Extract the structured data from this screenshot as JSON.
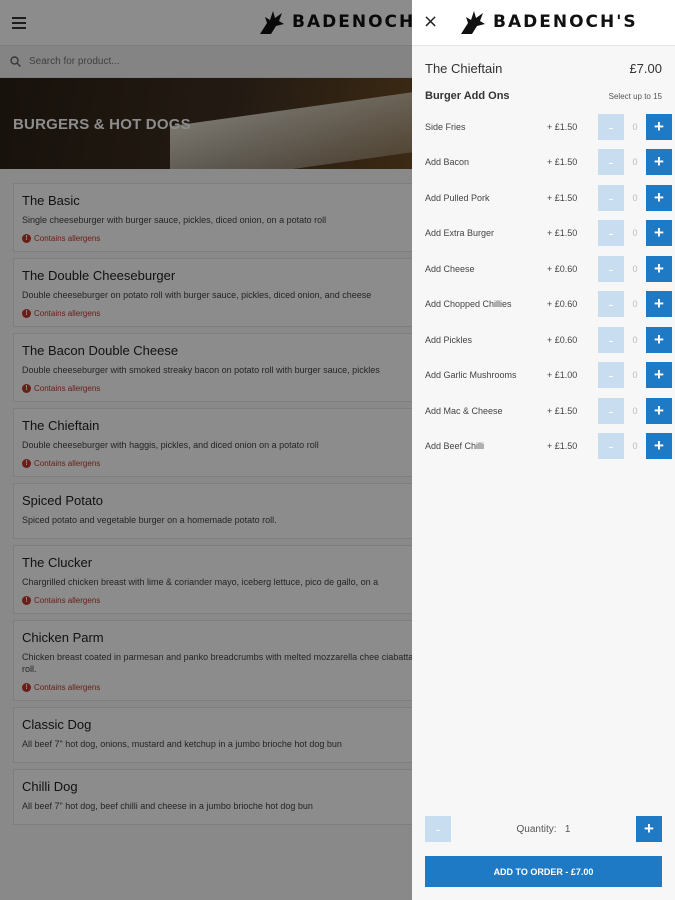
{
  "brand": {
    "name": "BADENOCH'S",
    "name_cropped": "BADENOCH'"
  },
  "search": {
    "placeholder": "Search for product..."
  },
  "hero": {
    "title": "BURGERS & HOT DOGS"
  },
  "allergen_label": "Contains allergens",
  "menu_items": [
    {
      "name": "The Basic",
      "desc": "Single cheeseburger with burger sauce, pickles, diced onion, on a potato roll",
      "allergens": true
    },
    {
      "name": "The Double Cheeseburger",
      "desc": "Double cheeseburger on potato roll with burger sauce, pickles, diced onion, and cheese",
      "allergens": true
    },
    {
      "name": "The Bacon Double Cheese",
      "desc": "Double cheeseburger with smoked streaky bacon on potato roll with burger sauce, pickles",
      "allergens": true
    },
    {
      "name": "The Chieftain",
      "desc": "Double cheeseburger with haggis, pickles, and diced onion on a potato roll",
      "allergens": true
    },
    {
      "name": "Spiced Potato",
      "desc": "Spiced potato and vegetable burger on a homemade potato roll.",
      "allergens": false
    },
    {
      "name": "The Clucker",
      "desc": "Chargrilled chicken breast with lime & coriander mayo, iceberg lettuce, pico de gallo, on a",
      "allergens": true
    },
    {
      "name": "Chicken Parm",
      "desc": "Chicken breast coated in parmesan and panko breadcrumbs with melted mozzarella chee ciabatta roll.",
      "allergens": true
    },
    {
      "name": "Classic Dog",
      "desc": "All beef 7\" hot dog, onions, mustard and ketchup in a jumbo brioche hot dog bun",
      "allergens": false
    },
    {
      "name": "Chilli Dog",
      "desc": "All beef 7\" hot dog, beef chilli and cheese in a jumbo brioche hot dog bun",
      "allergens": false
    }
  ],
  "panel": {
    "close_symbol": "×",
    "item_name": "The Chieftain",
    "item_price": "£7.00",
    "addons_title": "Burger Add Ons",
    "addons_hint": "Select up to 15",
    "minus_symbol": "-",
    "plus_symbol": "+",
    "addons": [
      {
        "name": "Side Fries",
        "price": "+ £1.50",
        "qty": "0"
      },
      {
        "name": "Add Bacon",
        "price": "+ £1.50",
        "qty": "0"
      },
      {
        "name": "Add Pulled Pork",
        "price": "+ £1.50",
        "qty": "0"
      },
      {
        "name": "Add Extra Burger",
        "price": "+ £1.50",
        "qty": "0"
      },
      {
        "name": "Add Cheese",
        "price": "+ £0.60",
        "qty": "0"
      },
      {
        "name": "Add Chopped Chillies",
        "price": "+ £0.60",
        "qty": "0"
      },
      {
        "name": "Add Pickles",
        "price": "+ £0.60",
        "qty": "0"
      },
      {
        "name": "Add Garlic Mushrooms",
        "price": "+ £1.00",
        "qty": "0"
      },
      {
        "name": "Add Mac & Cheese",
        "price": "+ £1.50",
        "qty": "0"
      },
      {
        "name": "Add Beef Chilli",
        "price": "+ £1.50",
        "qty": "0"
      }
    ],
    "quantity_label": "Quantity:",
    "quantity_value": "1",
    "add_to_order": "ADD TO ORDER  -  £7.00"
  },
  "colors": {
    "accent": "#1f7ac5",
    "accent_light": "#c8ddef",
    "allergen": "#c0392b"
  },
  "icons": {
    "menu": "hamburger-icon",
    "search": "search-icon",
    "logo": "wolf-logo-icon",
    "close": "close-icon",
    "allergen": "alert-icon"
  }
}
